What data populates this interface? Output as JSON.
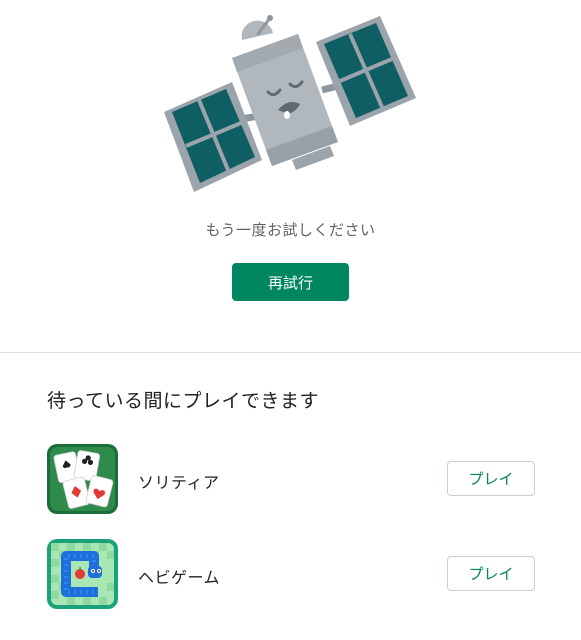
{
  "error": {
    "message": "もう一度お試しください",
    "retry_label": "再試行"
  },
  "games": {
    "heading": "待っている間にプレイできます",
    "items": [
      {
        "name": "ソリティア",
        "play_label": "プレイ",
        "icon": "solitaire-icon"
      },
      {
        "name": "ヘビゲーム",
        "play_label": "プレイ",
        "icon": "snake-icon"
      }
    ]
  },
  "colors": {
    "accent": "#01875f",
    "solar_panel": "#0f5e63",
    "satellite_body": "#b0b7bd"
  }
}
